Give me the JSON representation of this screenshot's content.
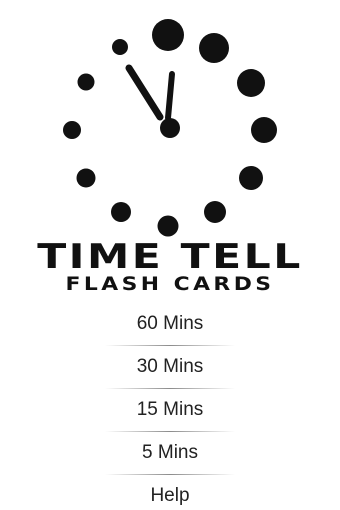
{
  "app": {
    "title_main": "TIME TELL",
    "title_sub": "FLASH CARDS"
  },
  "menu": {
    "items": [
      {
        "label": "60 Mins"
      },
      {
        "label": "30 Mins"
      },
      {
        "label": "15 Mins"
      },
      {
        "label": "5 Mins"
      },
      {
        "label": "Help"
      }
    ]
  },
  "icons": {
    "logo": "clock-icon"
  },
  "colors": {
    "background": "#ffffff",
    "ink": "#111111",
    "text": "#222222"
  }
}
